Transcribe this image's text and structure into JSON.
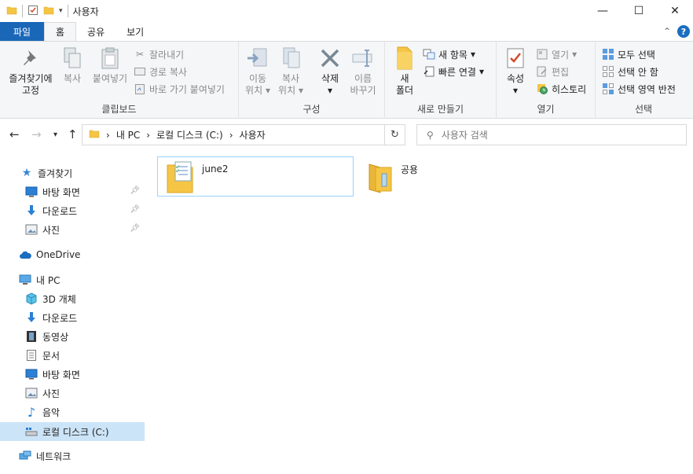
{
  "window": {
    "title": "사용자",
    "controls": {
      "minimize": "—",
      "maximize": "☐",
      "close": "✕"
    }
  },
  "tabs": {
    "file": "파일",
    "home": "홈",
    "share": "공유",
    "view": "보기",
    "help": "?"
  },
  "ribbon": {
    "clipboard": {
      "label": "클립보드",
      "pin_line1": "즐겨찾기에",
      "pin_line2": "고정",
      "copy": "복사",
      "paste": "붙여넣기",
      "cut": "잘라내기",
      "copy_path": "경로 복사",
      "paste_shortcut": "바로 가기 붙여넣기"
    },
    "organize": {
      "label": "구성",
      "move_line1": "이동",
      "move_line2": "위치",
      "copyto_line1": "복사",
      "copyto_line2": "위치",
      "delete": "삭제",
      "rename_line1": "이름",
      "rename_line2": "바꾸기"
    },
    "new": {
      "label": "새로 만들기",
      "folder_line1": "새",
      "folder_line2": "폴더",
      "new_item": "새 항목",
      "easy_access": "빠른 연결"
    },
    "open": {
      "label": "열기",
      "properties": "속성",
      "open": "열기",
      "edit": "편집",
      "history": "히스토리"
    },
    "select": {
      "label": "선택",
      "select_all": "모두 선택",
      "select_none": "선택 안 함",
      "invert": "선택 영역 반전"
    }
  },
  "address": {
    "crumbs": [
      "내 PC",
      "로컬 디스크 (C:)",
      "사용자"
    ],
    "search_placeholder": "사용자 검색"
  },
  "sidebar": {
    "quick_access": "즐겨찾기",
    "qa_items": [
      "바탕 화면",
      "다운로드",
      "사진"
    ],
    "onedrive": "OneDrive",
    "this_pc": "내 PC",
    "pc_items": [
      "3D 개체",
      "다운로드",
      "동영상",
      "문서",
      "바탕 화면",
      "사진",
      "음악",
      "로컬 디스크 (C:)"
    ],
    "network": "네트워크"
  },
  "content": {
    "items": [
      {
        "name": "june2"
      },
      {
        "name": "공용"
      }
    ]
  },
  "colors": {
    "accent": "#1a67b8",
    "folder": "#f5c545",
    "selection": "#cce4f7"
  }
}
